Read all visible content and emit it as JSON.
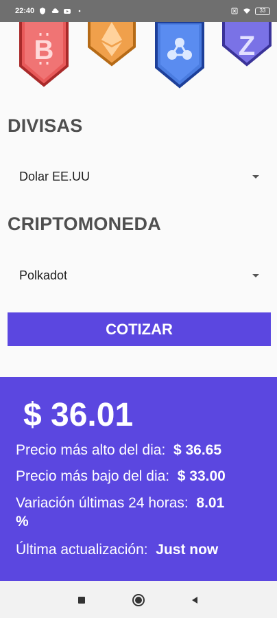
{
  "status_bar": {
    "time": "22:40",
    "battery": "33"
  },
  "header": {
    "badges": [
      {
        "icon": "bitcoin-icon",
        "color": "#e85a5a",
        "border": "#a92a2a",
        "glyph": "₿"
      },
      {
        "icon": "ethereum-icon",
        "color": "#f0a04b",
        "border": "#b56a16",
        "glyph": "◆"
      },
      {
        "icon": "ripple-icon",
        "color": "#4a7ce0",
        "border": "#1d3f99",
        "glyph": "✦"
      },
      {
        "icon": "zcoin-icon",
        "color": "#7a72e6",
        "border": "#3a3399",
        "glyph": "Z"
      }
    ]
  },
  "form": {
    "currency_label": "DIVISAS",
    "currency_value": "Dolar EE.UU",
    "crypto_label": "CRIPTOMONEDA",
    "crypto_value": "Polkadot",
    "submit_label": "COTIZAR"
  },
  "result": {
    "price": "$ 36.01",
    "high_label": "Precio más alto del dia:",
    "high_value": "$ 36.65",
    "low_label": "Precio más bajo del dia:",
    "low_value": "$ 33.00",
    "change_label": "Variación últimas 24 horas:",
    "change_value": "8.01",
    "change_unit": "%",
    "updated_label": "Última actualización:",
    "updated_value": "Just now"
  },
  "colors": {
    "accent": "#5b47e0"
  }
}
